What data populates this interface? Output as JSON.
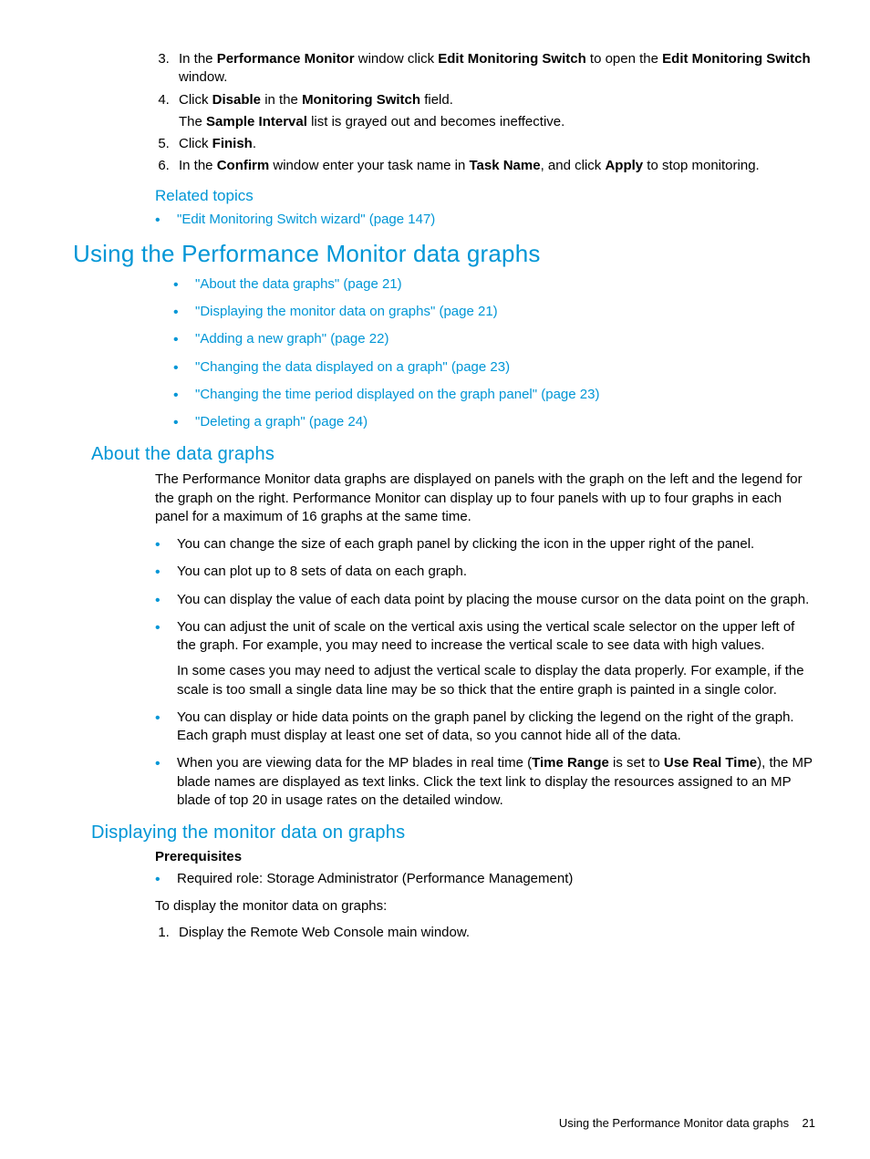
{
  "steps": {
    "s3": {
      "pre": "In the ",
      "b1": "Performance Monitor",
      "mid1": " window click ",
      "b2": "Edit Monitoring Switch",
      "mid2": " to open the ",
      "b3": "Edit Monitoring Switch",
      "post": " window."
    },
    "s4": {
      "pre": "Click ",
      "b1": "Disable",
      "mid1": " in the ",
      "b2": "Monitoring Switch",
      "post": " field.",
      "sub_pre": "The ",
      "sub_b": "Sample Interval",
      "sub_post": " list is grayed out and becomes ineffective."
    },
    "s5": {
      "pre": "Click ",
      "b1": "Finish",
      "post": "."
    },
    "s6": {
      "pre": "In the ",
      "b1": "Confirm",
      "mid1": " window enter your task name in ",
      "b2": "Task Name",
      "mid2": ", and click ",
      "b3": "Apply",
      "post": " to stop monitoring."
    }
  },
  "related": {
    "heading": "Related topics",
    "item1": "\"Edit Monitoring Switch wizard\" (page 147)"
  },
  "using": {
    "heading": "Using the Performance Monitor data graphs",
    "links": [
      "\"About the data graphs\" (page 21)",
      "\"Displaying the monitor data on graphs\" (page 21)",
      "\"Adding a new graph\" (page 22)",
      "\"Changing the data displayed on a graph\" (page 23)",
      "\"Changing the time period displayed on the graph panel\" (page 23)",
      "\"Deleting a graph\" (page 24)"
    ]
  },
  "about": {
    "heading": "About the data graphs",
    "intro": "The Performance Monitor data graphs are displayed on panels with the graph on the left and the legend for the graph on the right. Performance Monitor can display up to four panels with up to four graphs in each panel for a maximum of 16 graphs at the same time.",
    "b1": "You can change the size of each graph panel by clicking the icon in the upper right of the panel.",
    "b2": "You can plot up to 8 sets of data on each graph.",
    "b3": "You can display the value of each data point by placing the mouse cursor on the data point on the graph.",
    "b4": "You can adjust the unit of scale on the vertical axis using the vertical scale selector on the upper left of the graph. For example, you may need to increase the vertical scale to see data with high values.",
    "b4sub": "In some cases you may need to adjust the vertical scale to display the data properly. For example, if the scale is too small a single data line may be so thick that the entire graph is painted in a single color.",
    "b5": "You can display or hide data points on the graph panel by clicking the legend on the right of the graph. Each graph must display at least one set of data, so you cannot hide all of the data.",
    "b6_pre": "When you are viewing data for the MP blades in real time (",
    "b6_b1": "Time Range",
    "b6_mid1": " is set to ",
    "b6_b2": "Use Real Time",
    "b6_post": "), the MP blade names are displayed as text links. Click the text link to display the resources assigned to an MP blade of top 20 in usage rates on the detailed window."
  },
  "displaying": {
    "heading": "Displaying the monitor data on graphs",
    "prereq_heading": "Prerequisites",
    "prereq_item": "Required role: Storage Administrator (Performance Management)",
    "lead": "To display the monitor data on graphs:",
    "step1": "Display the Remote Web Console main window."
  },
  "footer": {
    "text": "Using the Performance Monitor data graphs",
    "page": "21"
  }
}
